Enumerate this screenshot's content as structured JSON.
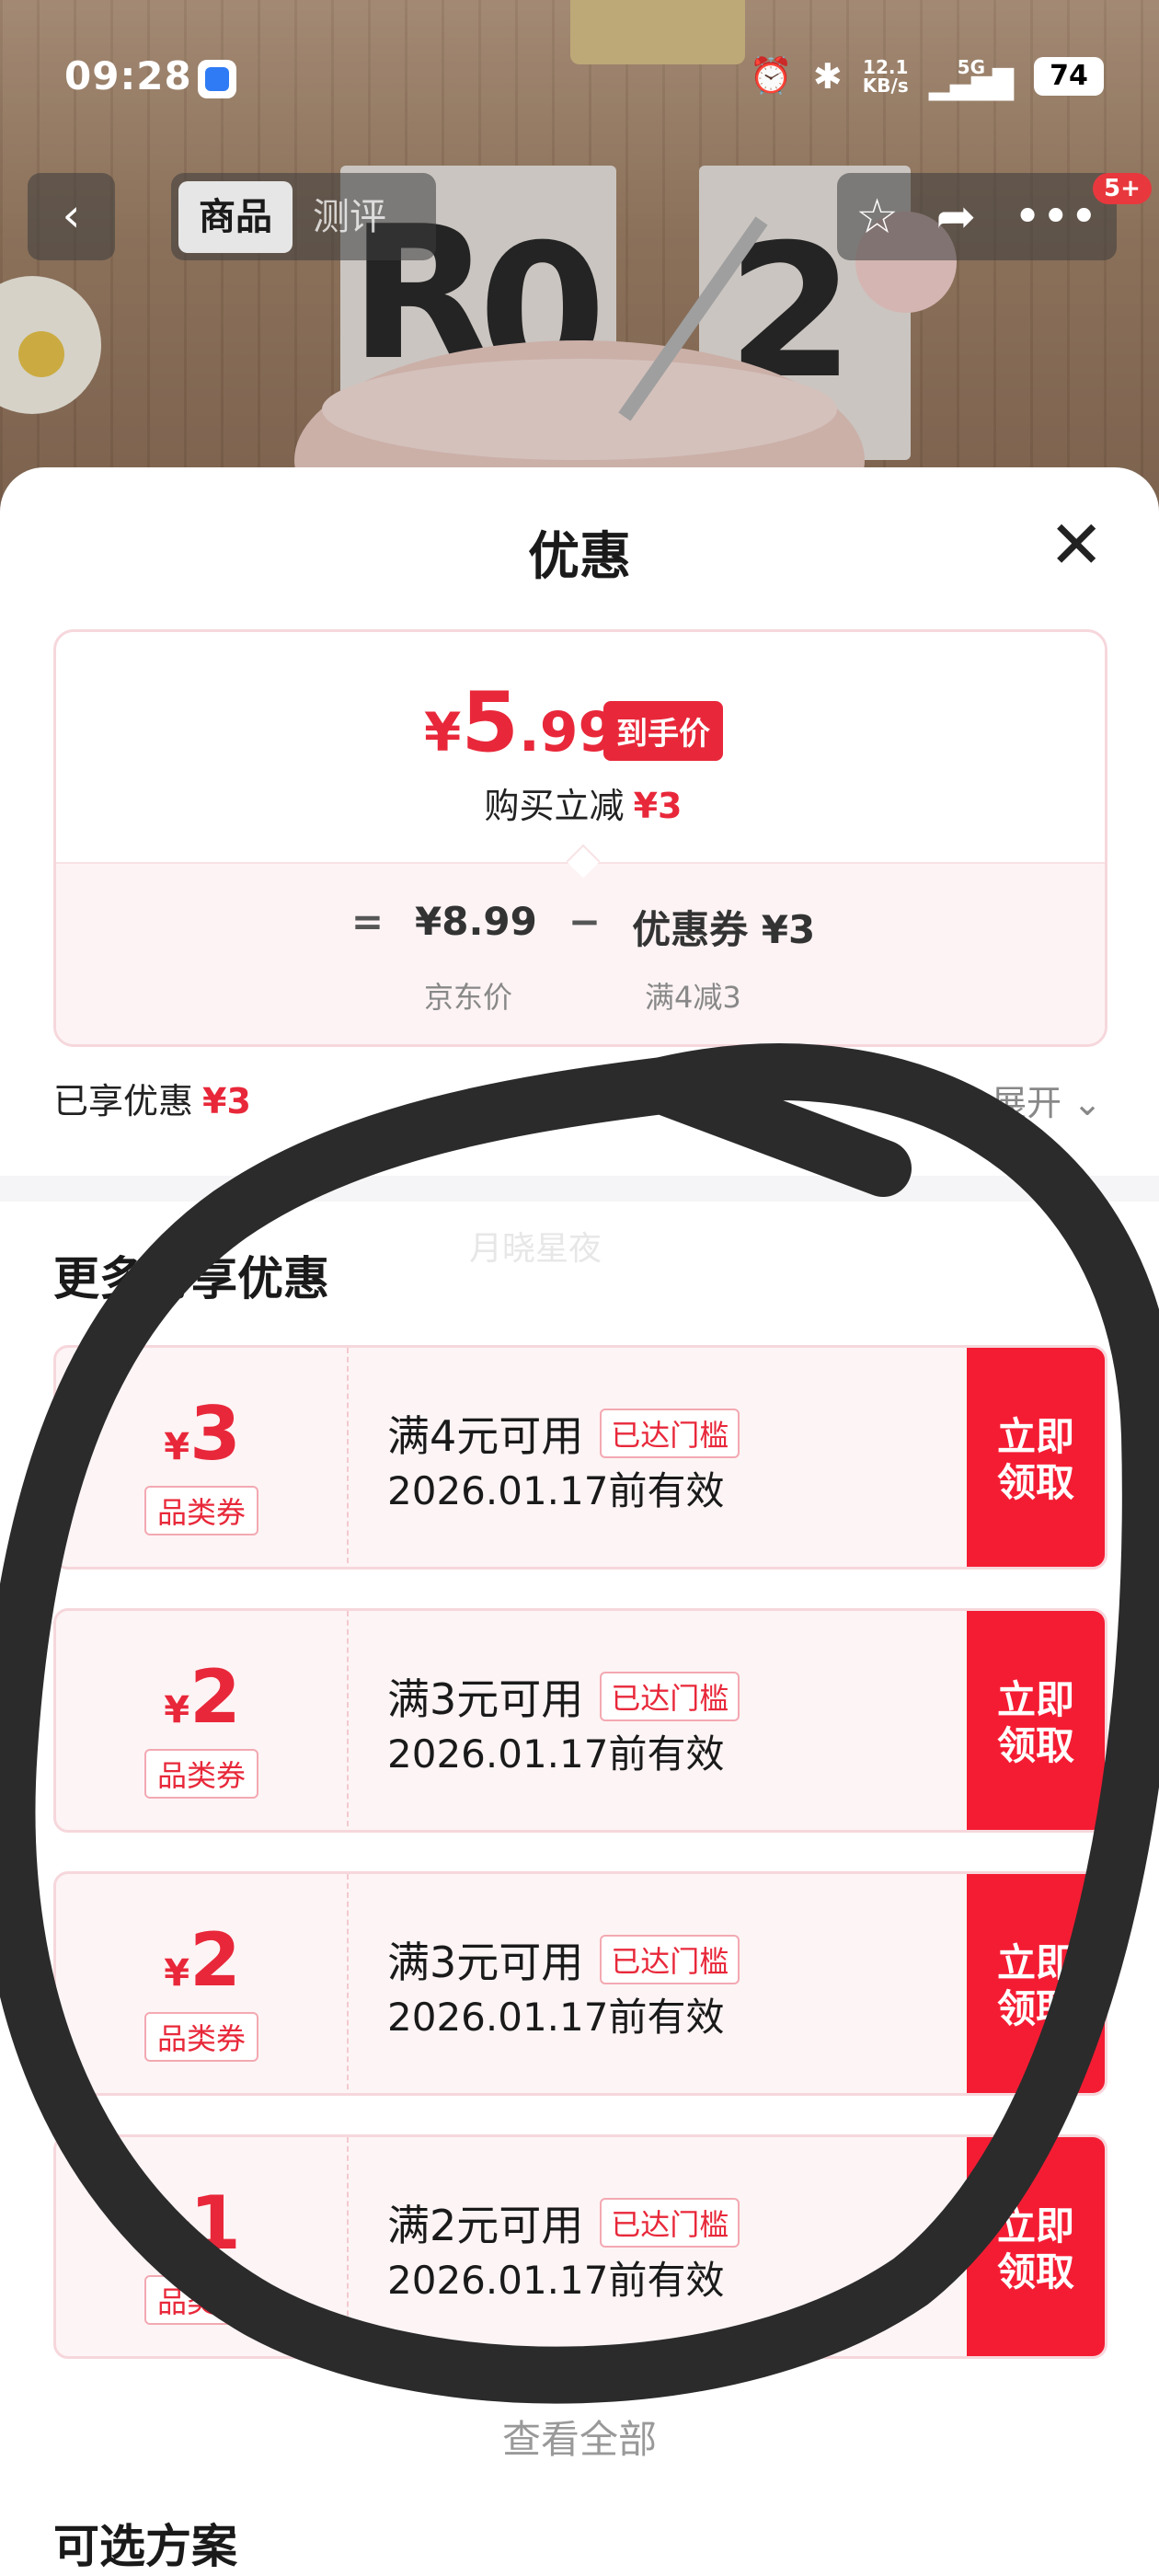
{
  "status_bar": {
    "time": "09:28",
    "net_speed": "12.1",
    "net_unit": "KB/s",
    "network": "5G",
    "battery": "74"
  },
  "nav": {
    "tabs": [
      {
        "label": "商品",
        "active": true
      },
      {
        "label": "测评",
        "active": false
      }
    ],
    "badge": "5+"
  },
  "sheet": {
    "title": "优惠",
    "final_price": {
      "yen": "¥",
      "integer": "5",
      "decimal": ".99",
      "tag": "到手价"
    },
    "reduce_label": "购买立减",
    "reduce_value": "¥3",
    "formula": {
      "equals": "=",
      "jd_price": "¥8.99",
      "minus": "−",
      "coupon_label": "优惠券",
      "coupon_value": "¥3",
      "jd_price_label": "京东价",
      "coupon_rule": "满4减3"
    },
    "enjoyed_label": "已享优惠",
    "enjoyed_value": "¥3",
    "expand_label": "展开",
    "watermark": "月晓星夜",
    "more_title": "更多可享优惠",
    "coupons": [
      {
        "amount": "3",
        "type": "品类券",
        "condition": "满4元可用",
        "reached": "已达门槛",
        "valid": "2026.01.17前有效",
        "claim": "立即领取"
      },
      {
        "amount": "2",
        "type": "品类券",
        "condition": "满3元可用",
        "reached": "已达门槛",
        "valid": "2026.01.17前有效",
        "claim": "立即领取"
      },
      {
        "amount": "2",
        "type": "品类券",
        "condition": "满3元可用",
        "reached": "已达门槛",
        "valid": "2026.01.17前有效",
        "claim": "立即领取"
      },
      {
        "amount": "1",
        "type": "品类券",
        "condition": "满2元可用",
        "reached": "已达门槛",
        "valid": "2026.01.17前有效",
        "claim": "立即领取"
      }
    ],
    "see_all": "查看全部",
    "next_section": "可选方案"
  },
  "colors": {
    "accent_red": "#e8283a",
    "claim_red": "#f41c33"
  }
}
